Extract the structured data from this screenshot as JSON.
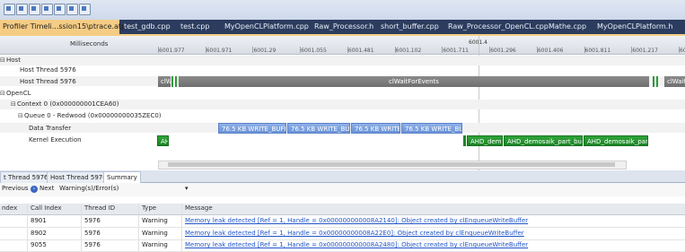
{
  "tabs": [
    {
      "label": "Profiler Timeli...ssion15\\ptrace.atp",
      "active": true,
      "pin": "✕"
    },
    {
      "label": "test_gdb.cpp"
    },
    {
      "label": "test.cpp"
    },
    {
      "label": "MyOpenCLPlatform.cpp"
    },
    {
      "label": "Raw_Processor.h"
    },
    {
      "label": "short_buffer.cpp"
    },
    {
      "label": "Raw_Processor_OpenCL.cpp"
    },
    {
      "label": "Mathe.cpp"
    },
    {
      "label": "MyOpenCLPlatform.h"
    }
  ],
  "timeline": {
    "ruler_label": "Milliseconds",
    "ticks": [
      "6001.977",
      "6001.971",
      "6001.29",
      "6001.055",
      "6001.481",
      "6001.102",
      "6001.711",
      "6001.296",
      "6001.406",
      "6001.811",
      "6001.217",
      "6001.81"
    ],
    "cursor_value": "6001.4",
    "rows": {
      "host": "Host",
      "host_thread_1": "Host Thread 5976",
      "host_thread_2": "Host Thread 5976",
      "opencl": "OpenCL",
      "context": "Context 0 (0x000000001CEA60)",
      "queue": "Queue 0 - Redwood (0x00000000035ZEC0)",
      "data_transfer": "Data Transfer",
      "kernel_execution": "Kernel Execution"
    },
    "host_bars": {
      "small_left": "clW",
      "main": "clWaitForEvents",
      "right": "clWait"
    },
    "transfer_bars": [
      "76.5 KB WRITE_BUFF",
      "76.5 KB WRITE_BUF",
      "76.5 KB WRITE_",
      "76.5 KB WRITE_BUFF"
    ],
    "kernel_bars": [
      "AH",
      "AHD_dem",
      "AHD_demosaik_part_build",
      "AHD_demosaik_part_"
    ]
  },
  "bottom_tabs": [
    {
      "label": "t Thread 5976"
    },
    {
      "label": "Host Thread 5976"
    },
    {
      "label": "Summary",
      "active": true
    }
  ],
  "filter": {
    "previous": "Previous",
    "next": "Next",
    "filter_value": "Warning(s)/Error(s)"
  },
  "table": {
    "headers": [
      "ndex",
      "Call Index",
      "Thread ID",
      "Type",
      "Message"
    ],
    "rows": [
      {
        "call_index": "8901",
        "thread_id": "5976",
        "type": "Warning",
        "message": "Memory leak detected [Ref = 1, Handle = 0x000000000008A2140]: Object created by clEnqueueWriteBuffer"
      },
      {
        "call_index": "8902",
        "thread_id": "5976",
        "type": "Warning",
        "message": "Memory leak detected [Ref = 1, Handle = 0x00000000008A22E0]: Object created by clEnqueueWriteBuffer"
      },
      {
        "call_index": "9055",
        "thread_id": "5976",
        "type": "Warning",
        "message": "Memory leak detected [Ref = 1, Handle = 0x000000000008A2480]: Object created by clEnqueueWriteBuffer"
      }
    ]
  },
  "colors": {
    "tab_active": "#f5cc84",
    "tabbar": "#2b3c5e",
    "kernel": "#1c8426",
    "transfer": "#6a92d6",
    "host": "#6f6f6f",
    "link": "#2055c8"
  }
}
